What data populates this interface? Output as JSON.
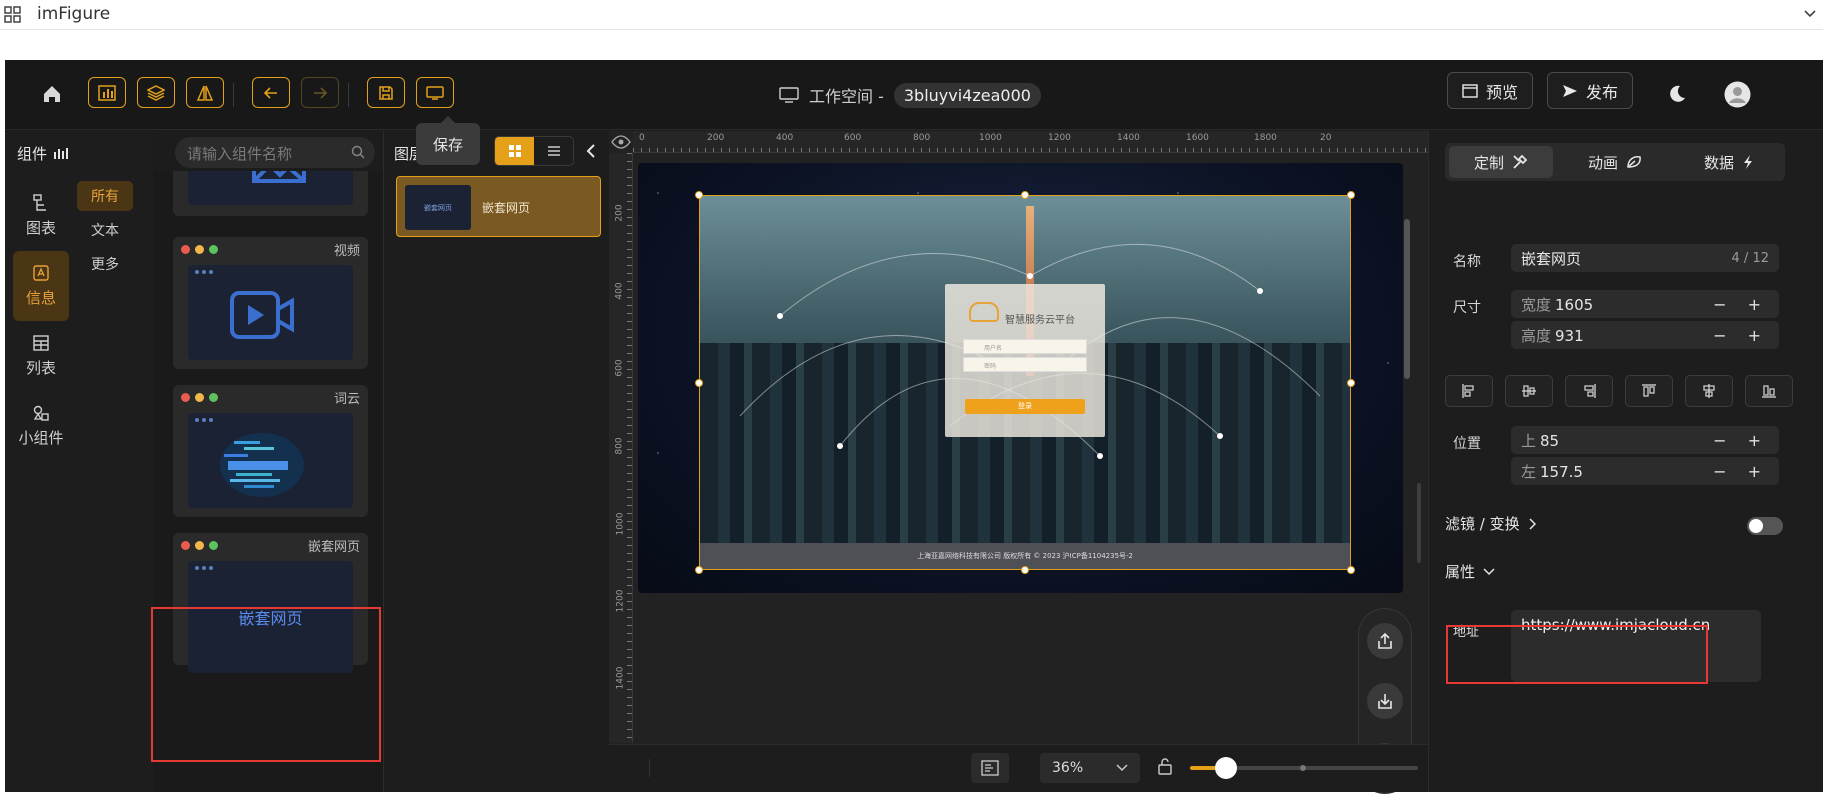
{
  "window": {
    "title": "imFigure"
  },
  "topbar": {
    "workspace_label": "工作空间 -",
    "workspace_id": "3bluyvi4zea000",
    "preview_label": "预览",
    "publish_label": "发布",
    "save_tooltip": "保存"
  },
  "components": {
    "header": "组件",
    "search_placeholder": "请输入组件名称",
    "nav": [
      "图表",
      "信息",
      "列表",
      "小组件"
    ],
    "active_nav": "信息",
    "sub": [
      "所有",
      "文本",
      "更多"
    ],
    "active_sub": "所有",
    "cards": [
      {
        "title": "视频"
      },
      {
        "title": "词云"
      },
      {
        "title": "嵌套网页",
        "preview_text": "嵌套网页"
      }
    ]
  },
  "layers": {
    "header": "图层",
    "items": [
      {
        "label": "嵌套网页",
        "thumb_text": "嵌套网页"
      }
    ]
  },
  "canvas": {
    "ruler_top": [
      "0",
      "200",
      "400",
      "600",
      "800",
      "1000",
      "1200",
      "1400",
      "1600",
      "1800",
      "20"
    ],
    "ruler_left": [
      "200",
      "400",
      "600",
      "800",
      "1000",
      "1200",
      "1400"
    ],
    "login_title": "智慧服务云平台",
    "login_user_placeholder": "用户名",
    "login_pass_placeholder": "密码",
    "login_button": "登录",
    "footer_text": "上海亚嘉网络科技有限公司 版权所有 © 2023 沪ICP备1104235号-2"
  },
  "bottombar": {
    "zoom": "36%",
    "slider_value": 0.16
  },
  "props": {
    "tabs": [
      "定制",
      "动画",
      "数据"
    ],
    "active_tab": "定制",
    "name_label": "名称",
    "name_value": "嵌套网页",
    "name_count": "4 / 12",
    "size_label": "尺寸",
    "width_prefix": "宽度",
    "width_value": "1605",
    "height_prefix": "高度",
    "height_value": "931",
    "pos_label": "位置",
    "top_prefix": "上",
    "top_value": "85",
    "left_prefix": "左",
    "left_value": "157.5",
    "filter_label": "滤镜 / 变换",
    "attr_label": "属性",
    "addr_label": "地址",
    "addr_value": "https://www.imjacloud.cn",
    "pm": "− +"
  },
  "colors": {
    "accent": "#e3a018",
    "highlight": "#e53935",
    "bg": "#1c1c1c"
  }
}
